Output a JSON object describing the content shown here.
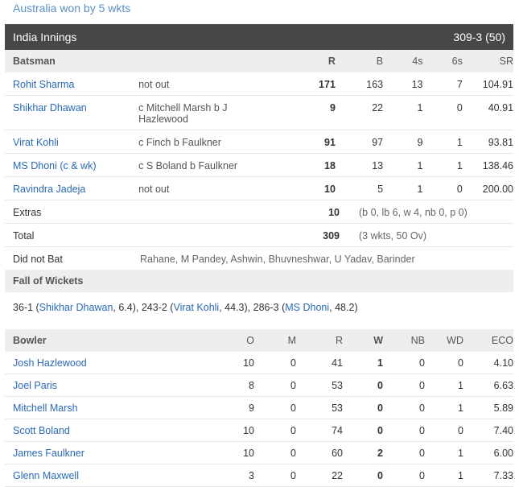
{
  "result": "Australia won by 5 wkts",
  "innings": {
    "title": "India Innings",
    "score": "309-3 (50)"
  },
  "batting_header": {
    "batsman": "Batsman",
    "r": "R",
    "b": "B",
    "fours": "4s",
    "sixes": "6s",
    "sr": "SR"
  },
  "batsmen": [
    {
      "name": "Rohit Sharma",
      "dismissal": "not out",
      "r": "171",
      "b": "163",
      "fours": "13",
      "sixes": "7",
      "sr": "104.91"
    },
    {
      "name": "Shikhar Dhawan",
      "dismissal": "c Mitchell Marsh b J Hazlewood",
      "r": "9",
      "b": "22",
      "fours": "1",
      "sixes": "0",
      "sr": "40.91"
    },
    {
      "name": "Virat Kohli",
      "dismissal": "c Finch b Faulkner",
      "r": "91",
      "b": "97",
      "fours": "9",
      "sixes": "1",
      "sr": "93.81"
    },
    {
      "name": "MS Dhoni (c & wk)",
      "dismissal": "c S Boland b Faulkner",
      "r": "18",
      "b": "13",
      "fours": "1",
      "sixes": "1",
      "sr": "138.46"
    },
    {
      "name": "Ravindra Jadeja",
      "dismissal": "not out",
      "r": "10",
      "b": "5",
      "fours": "1",
      "sixes": "0",
      "sr": "200.00"
    }
  ],
  "extras": {
    "label": "Extras",
    "value": "10",
    "detail": "(b 0, lb 6, w 4, nb 0, p 0)"
  },
  "total": {
    "label": "Total",
    "value": "309",
    "detail": "(3 wkts, 50 Ov)"
  },
  "did_not_bat": {
    "label": "Did not Bat",
    "players": "Rahane, M Pandey, Ashwin, Bhuvneshwar, U Yadav, Barinder"
  },
  "fall_of_wickets": {
    "title": "Fall of Wickets",
    "items": [
      {
        "score": "36-1",
        "player": "Shikhar Dhawan",
        "over": "6.4"
      },
      {
        "score": "243-2",
        "player": "Virat Kohli",
        "over": "44.3"
      },
      {
        "score": "286-3",
        "player": "MS Dhoni",
        "over": "48.2"
      }
    ]
  },
  "bowling_header": {
    "bowler": "Bowler",
    "o": "O",
    "m": "M",
    "r": "R",
    "w": "W",
    "nb": "NB",
    "wd": "WD",
    "eco": "ECO"
  },
  "bowlers": [
    {
      "name": "Josh Hazlewood",
      "o": "10",
      "m": "0",
      "r": "41",
      "w": "1",
      "nb": "0",
      "wd": "0",
      "eco": "4.10"
    },
    {
      "name": "Joel Paris",
      "o": "8",
      "m": "0",
      "r": "53",
      "w": "0",
      "nb": "0",
      "wd": "1",
      "eco": "6.63"
    },
    {
      "name": "Mitchell Marsh",
      "o": "9",
      "m": "0",
      "r": "53",
      "w": "0",
      "nb": "0",
      "wd": "1",
      "eco": "5.89"
    },
    {
      "name": "Scott Boland",
      "o": "10",
      "m": "0",
      "r": "74",
      "w": "0",
      "nb": "0",
      "wd": "0",
      "eco": "7.40"
    },
    {
      "name": "James Faulkner",
      "o": "10",
      "m": "0",
      "r": "60",
      "w": "2",
      "nb": "0",
      "wd": "1",
      "eco": "6.00"
    },
    {
      "name": "Glenn Maxwell",
      "o": "3",
      "m": "0",
      "r": "22",
      "w": "0",
      "nb": "0",
      "wd": "1",
      "eco": "7.33"
    }
  ],
  "colors": {
    "link": "#2a6ab4",
    "result": "#5a8fc4",
    "header_bg": "#474747",
    "subheader_bg": "#eeeeee"
  }
}
